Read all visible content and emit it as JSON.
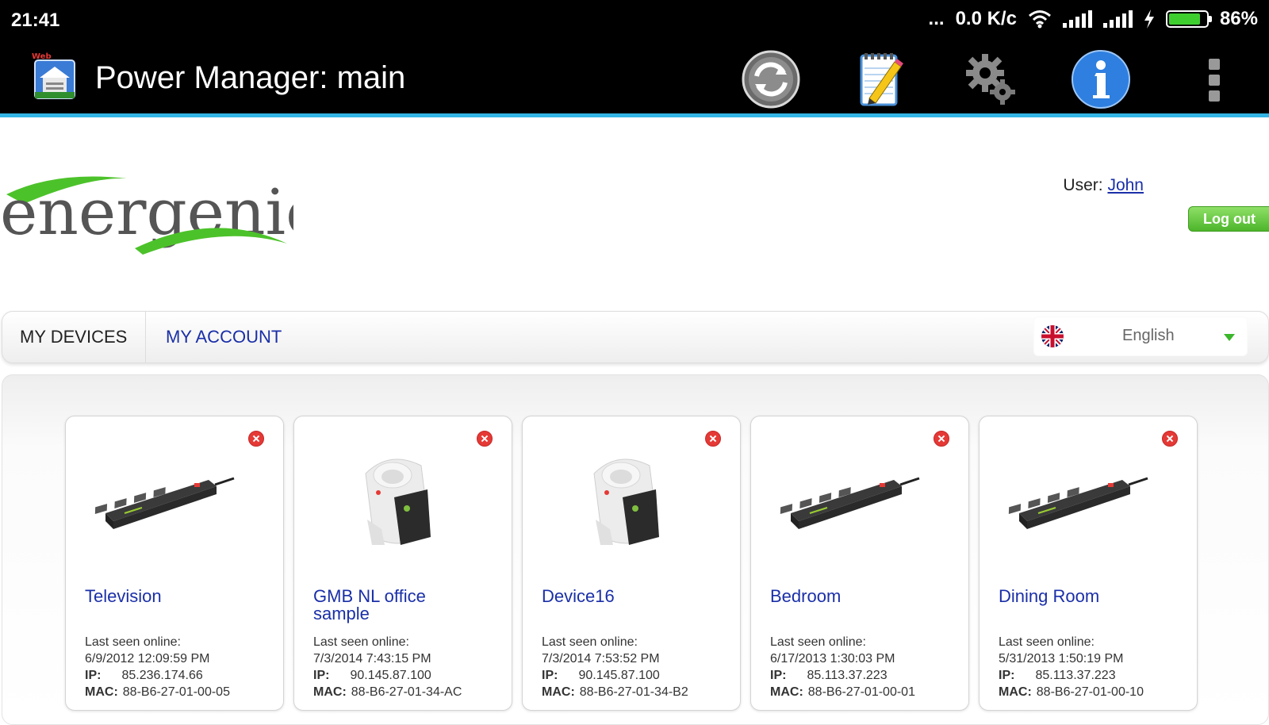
{
  "status_bar": {
    "time": "21:41",
    "dots": "...",
    "speed": "0.0 K/c",
    "battery_percent": "86%",
    "battery_level": 0.86,
    "icons": [
      "wifi-icon",
      "signal-icon",
      "signal-icon",
      "charging-icon",
      "battery-icon"
    ]
  },
  "action_bar": {
    "title": "Power Manager: main",
    "app_icon_badge": "Web",
    "actions": [
      "refresh-icon",
      "notepad-icon",
      "settings-gears-icon",
      "info-icon",
      "overflow-menu-icon"
    ]
  },
  "header": {
    "logo_text": "energenie",
    "user_label": "User:",
    "user_name": "John",
    "logout_label": "Log out"
  },
  "nav": {
    "tabs": [
      {
        "label": "MY DEVICES"
      },
      {
        "label": "MY ACCOUNT"
      }
    ],
    "language": {
      "selected": "English",
      "flag": "uk-flag-icon"
    }
  },
  "devices": [
    {
      "name": "Television",
      "image": "power-strip",
      "last_seen_label": "Last seen online:",
      "last_seen": "6/9/2012 12:09:59 PM",
      "ip_label": "IP:",
      "ip": "85.236.174.66",
      "mac_label": "MAC:",
      "mac": "88-B6-27-01-00-05"
    },
    {
      "name": "GMB NL office sample",
      "image": "smart-plug",
      "last_seen_label": "Last seen online:",
      "last_seen": "7/3/2014 7:43:15 PM",
      "ip_label": "IP:",
      "ip": "90.145.87.100",
      "mac_label": "MAC:",
      "mac": "88-B6-27-01-34-AC"
    },
    {
      "name": "Device16",
      "image": "smart-plug",
      "last_seen_label": "Last seen online:",
      "last_seen": "7/3/2014 7:53:52 PM",
      "ip_label": "IP:",
      "ip": "90.145.87.100",
      "mac_label": "MAC:",
      "mac": "88-B6-27-01-34-B2"
    },
    {
      "name": "Bedroom",
      "image": "power-strip",
      "last_seen_label": "Last seen online:",
      "last_seen": "6/17/2013 1:30:03 PM",
      "ip_label": "IP:",
      "ip": "85.113.37.223",
      "mac_label": "MAC:",
      "mac": "88-B6-27-01-00-01"
    },
    {
      "name": "Dining Room",
      "image": "power-strip",
      "last_seen_label": "Last seen online:",
      "last_seen": "5/31/2013 1:50:19 PM",
      "ip_label": "IP:",
      "ip": "85.113.37.223",
      "mac_label": "MAC:",
      "mac": "88-B6-27-01-00-10"
    }
  ],
  "colors": {
    "accent_blue": "#1a2fa8",
    "action_bar_underline": "#33b5e5",
    "logo_green": "#4cc22a",
    "logo_gray": "#555555",
    "delete_red": "#e53935"
  }
}
